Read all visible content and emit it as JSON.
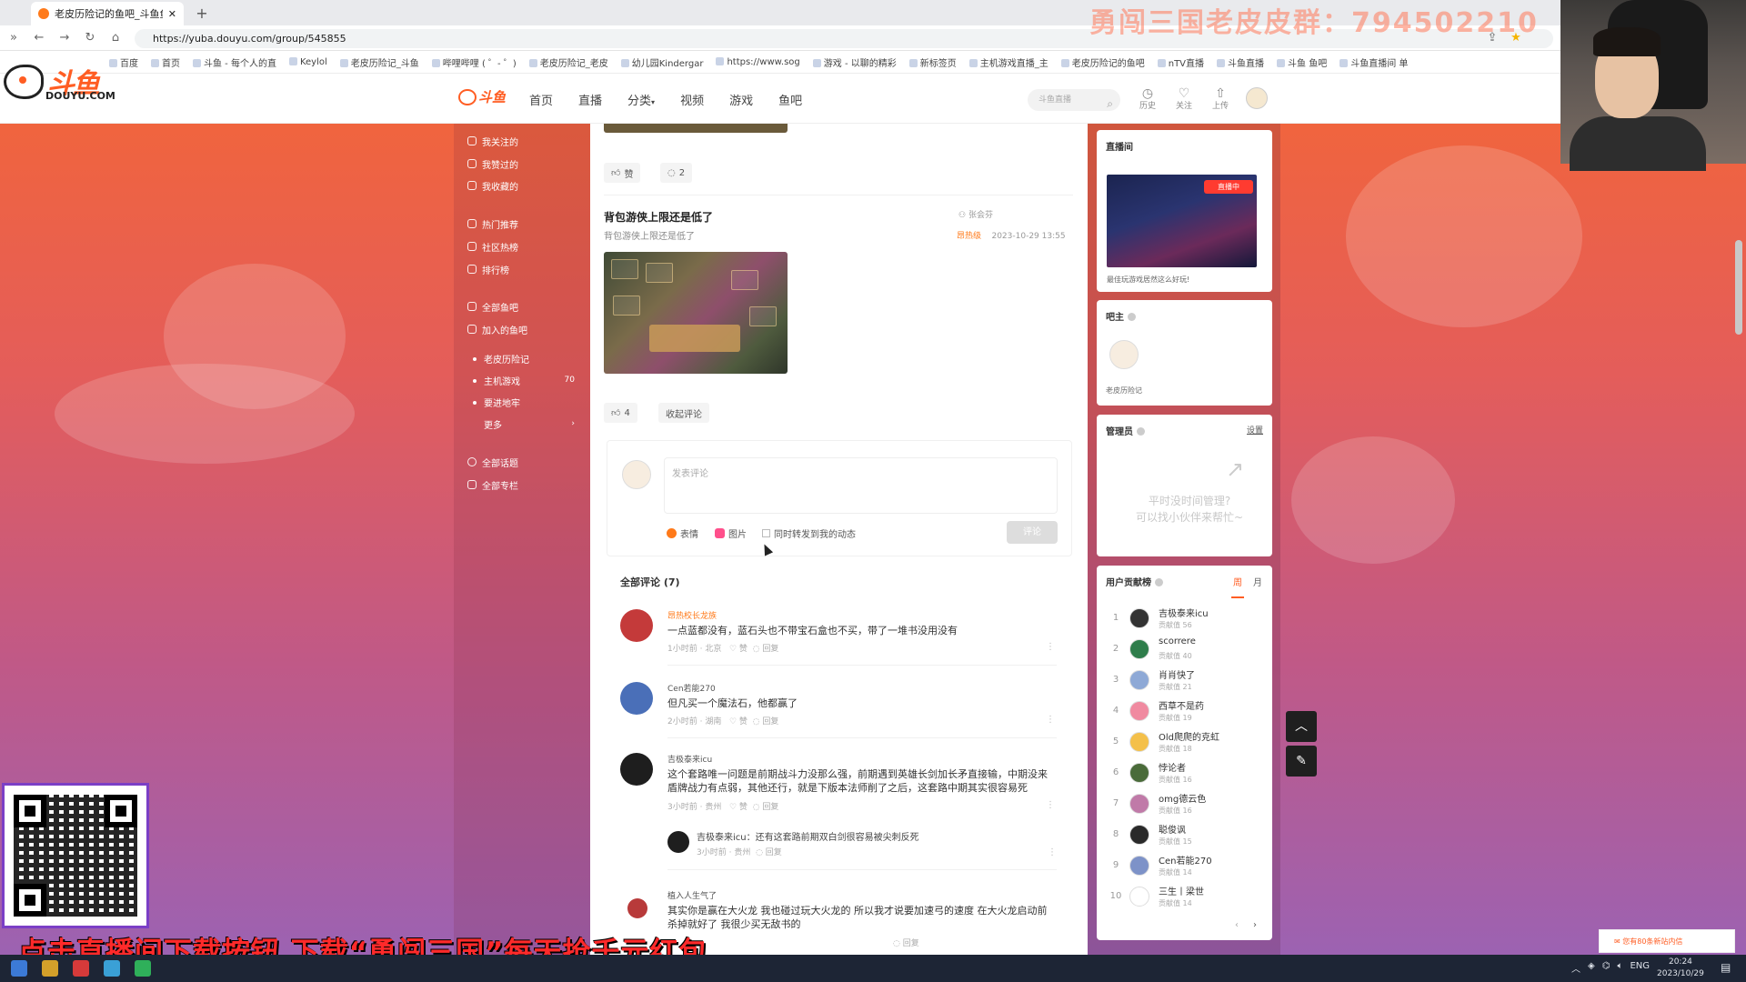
{
  "browser": {
    "tab_title": "老皮历险记的鱼吧_斗鱼鱼吧",
    "new_tab": "+",
    "url": "https://yuba.douyu.com/group/545855",
    "bookmarks": [
      "百度",
      "首页",
      "斗鱼 - 每个人的直",
      "Keylol",
      "老皮历险记_斗鱼",
      "哔哩哔哩 ( ゜- ゜)",
      "老皮历险记_老皮",
      "幼儿园Kindergar",
      "https://www.sog",
      "游戏 - 以聊的精彩",
      "新标签页",
      "主机游戏直播_主",
      "老皮历险记的鱼吧",
      "nTV直播",
      "斗鱼直播",
      "斗鱼 鱼吧",
      "斗鱼直播间 单"
    ]
  },
  "site": {
    "logo_text": "斗鱼",
    "logo_sub": "DOUYU.COM",
    "nav": [
      "首页",
      "直播",
      "分类",
      "视频",
      "游戏",
      "鱼吧"
    ],
    "search_placeholder": "斗鱼直播",
    "header_icons": [
      {
        "name": "history-icon",
        "label": "历史"
      },
      {
        "name": "follow-icon",
        "label": "关注"
      },
      {
        "name": "upload-icon",
        "label": "上传"
      }
    ]
  },
  "sidebar": {
    "groups": [
      [
        {
          "label": "我关注的"
        },
        {
          "label": "我赞过的"
        },
        {
          "label": "我收藏的"
        }
      ],
      [
        {
          "label": "热门推荐"
        },
        {
          "label": "社区热榜"
        },
        {
          "label": "排行榜"
        }
      ],
      [
        {
          "label": "全部鱼吧"
        },
        {
          "label": "加入的鱼吧"
        }
      ]
    ],
    "joined": [
      {
        "label": "老皮历险记",
        "count": ""
      },
      {
        "label": "主机游戏",
        "count": "70"
      },
      {
        "label": "要进地牢",
        "count": ""
      },
      {
        "label": "更多",
        "count": "›"
      }
    ],
    "bottom": [
      {
        "label": "全部话题"
      },
      {
        "label": "全部专栏"
      }
    ]
  },
  "prev_post": {
    "like_label": "赞",
    "comment_count": "2"
  },
  "post": {
    "title": "背包游侠上限还是低了",
    "subtitle": "背包游侠上限还是低了",
    "author": "张会芬",
    "tag": "昂热级",
    "time": "2023-10-29 13:55",
    "likes": "4",
    "collapse_label": "收起评论"
  },
  "composer": {
    "placeholder": "发表评论",
    "emoji_label": "表情",
    "image_label": "图片",
    "sync_label": "同时转发到我的动态",
    "submit_label": "评论"
  },
  "comments_header": "全部评论 (7)",
  "comments": [
    {
      "name": "昂热校长龙族",
      "text": "一点蓝都没有，蓝石头也不带宝石盒也不买，带了一堆书没用没有",
      "time": "1小时前",
      "loc": "北京",
      "like": "赞",
      "reply": "回复",
      "avatar_color": "#c43a3a"
    },
    {
      "name": "Cen若能270",
      "text": "但凡买一个魔法石，他都赢了",
      "time": "2小时前",
      "loc": "湖南",
      "like": "赞",
      "reply": "回复",
      "avatar_color": "#4a6fb8"
    },
    {
      "name": "吉极泰来icu",
      "text": "这个套路唯一问题是前期战斗力没那么强，前期遇到英雄长剑加长矛直接输，中期没来盾牌战力有点弱，其他还行，就是下版本法师削了之后，这套路中期其实很容易死",
      "time": "3小时前",
      "loc": "贵州",
      "like": "赞",
      "reply": "回复",
      "avatar_color": "#1e1e1e"
    },
    {
      "name": "植入人生气了",
      "text": "其实你是赢在大火龙 我也碰过玩大火龙的 所以我才说要加速弓的速度 在大火龙启动前杀掉就好了 我很少买无敌书的",
      "time": "",
      "loc": "",
      "like": "",
      "reply": "回复",
      "avatar_color": "#b83a3a"
    }
  ],
  "reply": {
    "name": "吉极泰来icu",
    "text": "还有这套路前期双白剑很容易被尖刺反死",
    "time": "3小时前",
    "loc": "贵州",
    "action": "回复"
  },
  "right": {
    "live_title": "直播间",
    "live_badge": "直播中",
    "live_caption": "最佳玩游戏居然这么好玩!",
    "owner_title": "吧主",
    "owner_name": "老皮历险记",
    "admin_title": "管理员",
    "admin_link": "设置",
    "admin_empty_1": "平时没时间管理?",
    "admin_empty_2": "可以找小伙伴来帮忙~",
    "rank_title": "用户贡献榜",
    "rank_tabs": [
      "周",
      "月"
    ],
    "ranking": [
      {
        "no": "1",
        "name": "吉极泰来icu",
        "score": "贡献值 56",
        "color": "#333"
      },
      {
        "no": "2",
        "name": "scorrere",
        "score": "贡献值 40",
        "color": "#2f7d4b"
      },
      {
        "no": "3",
        "name": "肖肖快了",
        "score": "贡献值 21",
        "color": "#8ea9d6"
      },
      {
        "no": "4",
        "name": "西草不是药",
        "score": "贡献值 19",
        "color": "#f08aa0"
      },
      {
        "no": "5",
        "name": "Old爬爬的克虹",
        "score": "贡献值 18",
        "color": "#f4c04a"
      },
      {
        "no": "6",
        "name": "悖论者",
        "score": "贡献值 16",
        "color": "#4a6b3a"
      },
      {
        "no": "7",
        "name": "omg德云色",
        "score": "贡献值 16",
        "color": "#c07aa8"
      },
      {
        "no": "8",
        "name": "聪俊讽",
        "score": "贡献值 15",
        "color": "#2a2a2a"
      },
      {
        "no": "9",
        "name": "Cen若能270",
        "score": "贡献值 14",
        "color": "#7d92c8"
      },
      {
        "no": "10",
        "name": "三生丨梁世",
        "score": "贡献值 14",
        "color": "#ffffff"
      }
    ],
    "pager": [
      "‹",
      "›"
    ]
  },
  "stream": {
    "watermark": "勇闯三国老皮皮群：794502210",
    "promo": "点击直播间下载按钮 下载“勇闯三国”每天抢千元红包",
    "notice": "您有80条新站内信"
  },
  "taskbar": {
    "lang": "ENG",
    "time": "20:24",
    "date": "2023/10/29"
  }
}
